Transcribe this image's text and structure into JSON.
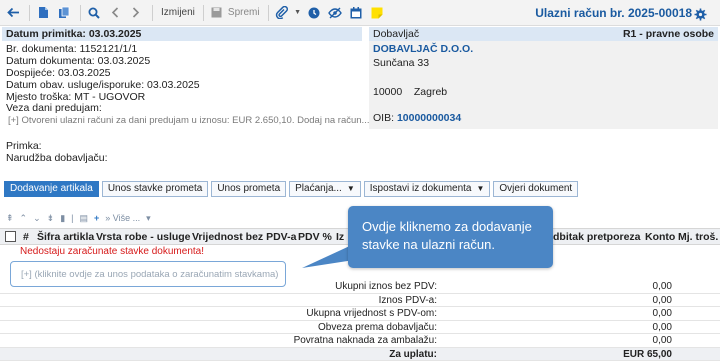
{
  "toolbar": {
    "items": [
      "back-arrow-icon",
      "new-document-icon",
      "copy-icon",
      "search-icon",
      "previous-icon",
      "next-icon"
    ],
    "edit_label": "Izmijeni",
    "save_label": "Spremi",
    "document_title": "Ulazni račun br. 2025-00018"
  },
  "receipt": {
    "heading": "Datum primitka: 03.03.2025",
    "lines": [
      "Br. dokumenta: 1152121/1/1",
      "Datum dokumenta: 03.03.2025",
      "Dospijeće: 03.03.2025",
      "Datum obav. usluge/isporuke: 03.03.2025",
      "Mjesto troška: MT - UGOVOR",
      "Veza dani predujam:"
    ],
    "advance_hint": "[+] Otvoreni ulazni računi za dani predujam u iznosu: EUR 2.650,10. Dodaj na račun...",
    "primka_label": "Primka:",
    "order_label": "Narudžba dobavljaču:"
  },
  "supplier": {
    "heading": "Dobavljač",
    "type": "R1 - pravne osobe",
    "name": "DOBAVLJAČ D.O.O.",
    "street": "Sunčana 33",
    "postal": "10000",
    "city": "Zagreb",
    "oib_label": "OIB:",
    "oib_value": "10000000034"
  },
  "actions": {
    "add_items": "Dodavanje artikala",
    "turnover_items": "Unos stavke prometa",
    "turnover": "Unos prometa",
    "payment": "Plaćanja...",
    "issue_from_doc": "Ispostavi iz dokumenta",
    "verify": "Ovjeri dokument"
  },
  "grid": {
    "more_label": "» Više ...",
    "columns": [
      "#",
      "Šifra artikla",
      "Vrsta robe - usluge",
      "Vrijednost bez PDV-a",
      "PDV %",
      "Iz",
      "dbitak pretporeza",
      "Konto",
      "Mj. troš."
    ],
    "error": "Nedostaju zaračunate stavke dokumenta!",
    "add_row_hint": "[+] (kliknite ovdje za unos podataka o zaračunatim stavkama)"
  },
  "tooltip": {
    "text": "Ovdje kliknemo za dodavanje stavke na ulazni račun."
  },
  "totals": [
    {
      "label": "Ukupni iznos bez PDV:",
      "value": "0,00"
    },
    {
      "label": "Iznos PDV-a:",
      "value": "0,00"
    },
    {
      "label": "Ukupna vrijednost s PDV-om:",
      "value": "0,00"
    },
    {
      "label": "Obveza prema dobavljaču:",
      "value": "0,00"
    },
    {
      "label": "Povratna naknada za ambalažu:",
      "value": "0,00"
    },
    {
      "label": "Za uplatu:",
      "value": "EUR 65,00"
    }
  ],
  "colors": {
    "accent": "#1a5aa0",
    "button_primary": "#2f78c4",
    "tooltip": "#4b86c5",
    "error": "#d61a1a"
  }
}
